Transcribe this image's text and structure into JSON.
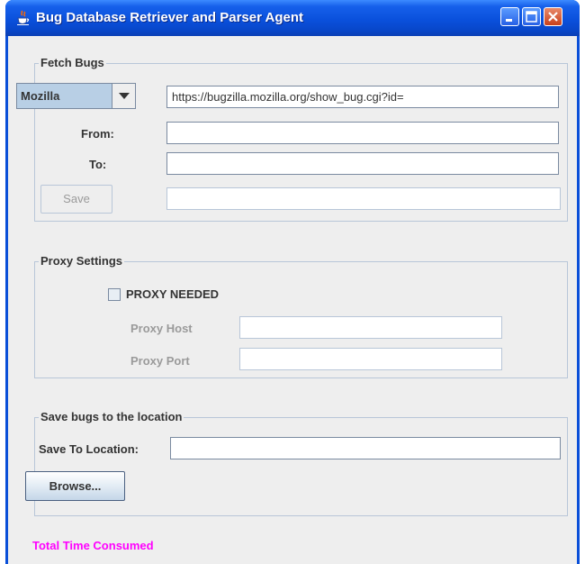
{
  "window": {
    "title": "Bug Database Retriever and Parser Agent"
  },
  "fetch_bugs": {
    "group_title": "Fetch Bugs",
    "source_select": "Mozilla",
    "url_value": "https://bugzilla.mozilla.org/show_bug.cgi?id=",
    "from_label": "From:",
    "from_value": "",
    "to_label": "To:",
    "to_value": "",
    "save_label": "Save",
    "save_status_value": ""
  },
  "proxy": {
    "group_title": "Proxy Settings",
    "checkbox_label": "PROXY NEEDED",
    "checked": false,
    "host_label": "Proxy Host",
    "host_value": "",
    "port_label": "Proxy Port",
    "port_value": ""
  },
  "save_location": {
    "group_title": "Save bugs to the location",
    "location_label": "Save To Location:",
    "location_value": "",
    "browse_label": "Browse..."
  },
  "status": {
    "total_time": "Total Time Consumed"
  },
  "colors": {
    "titlebar": "#0a50dc",
    "status_text": "#ff00ff",
    "panel_bg": "#eeeeee"
  },
  "icons": {
    "window": "java-cup-icon",
    "dropdown": "triangle-down-icon"
  }
}
